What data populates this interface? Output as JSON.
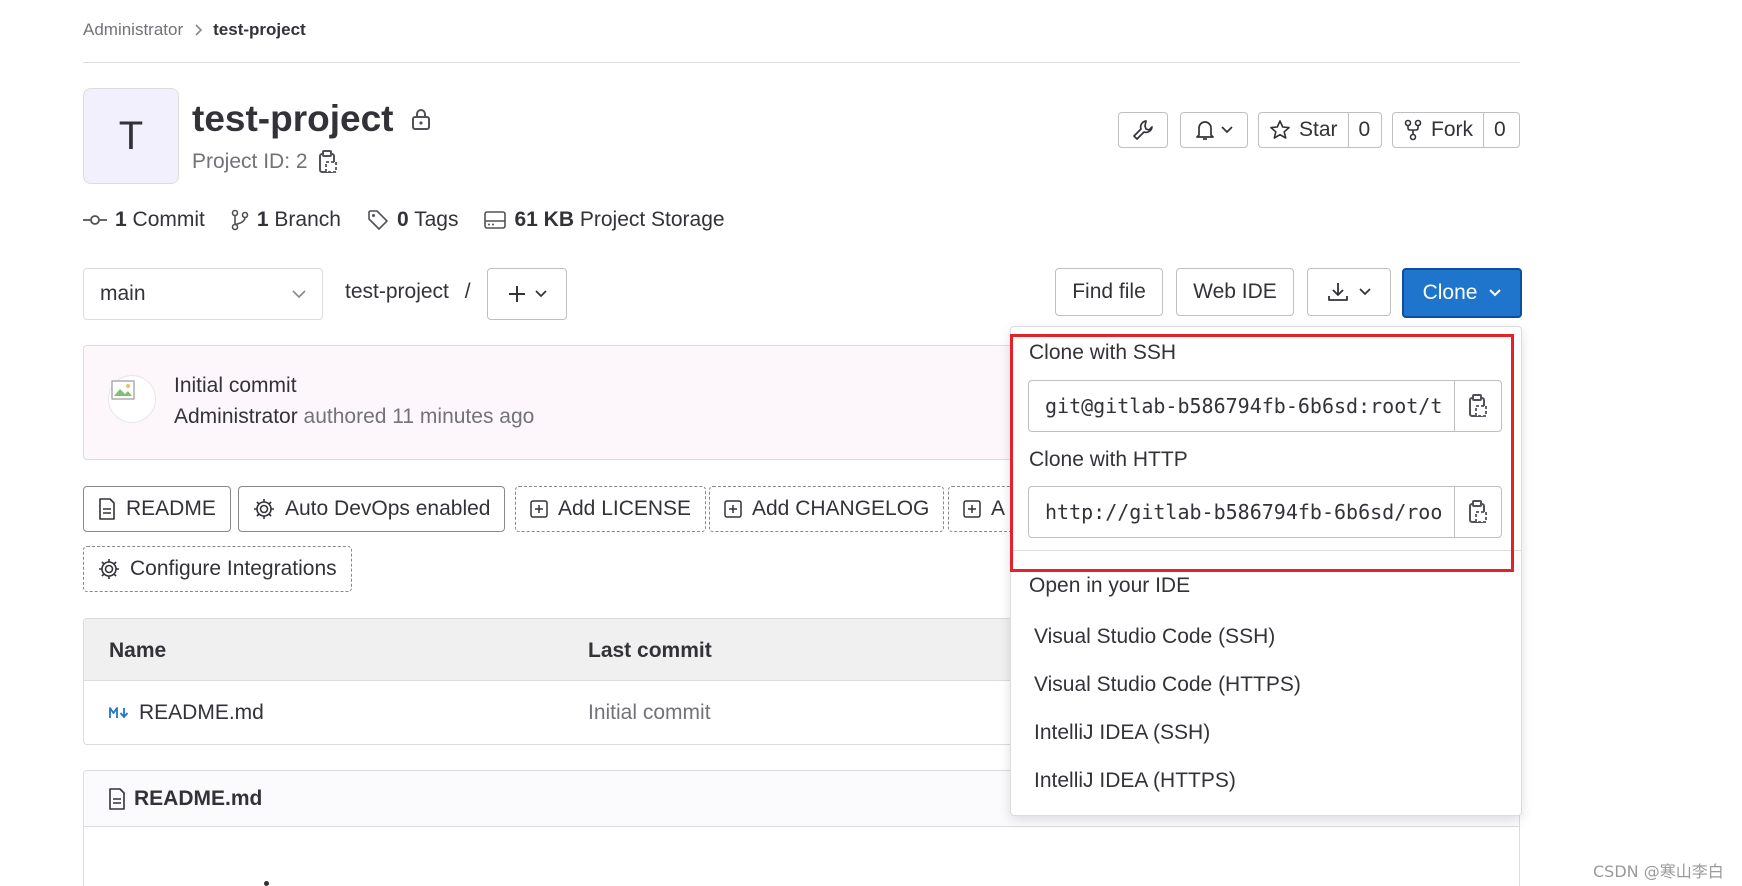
{
  "breadcrumb": {
    "parent": "Administrator",
    "current": "test-project"
  },
  "project": {
    "avatar_letter": "T",
    "name": "test-project",
    "id_text": "Project ID: 2"
  },
  "header_actions": {
    "star_label": "Star",
    "star_count": "0",
    "fork_label": "Fork",
    "fork_count": "0"
  },
  "stats": {
    "commits_num": "1",
    "commits_label": "Commit",
    "branches_num": "1",
    "branches_label": "Branch",
    "tags_num": "0",
    "tags_label": "Tags",
    "storage_num": "61 KB",
    "storage_label": "Project Storage"
  },
  "toolbar": {
    "branch": "main",
    "path": "test-project",
    "path_sep": "/",
    "find_file": "Find file",
    "web_ide": "Web IDE",
    "clone": "Clone"
  },
  "commit": {
    "title": "Initial commit",
    "author": "Administrator",
    "meta": "authored 11 minutes ago"
  },
  "quick_actions": {
    "readme": "README",
    "auto_devops": "Auto DevOps enabled",
    "add_license": "Add LICENSE",
    "add_changelog": "Add CHANGELOG",
    "add_partial": "A",
    "configure_integrations": "Configure Integrations"
  },
  "file_table": {
    "headers": [
      "Name",
      "Last commit"
    ],
    "rows": [
      {
        "name": "README.md",
        "last_commit": "Initial commit"
      }
    ]
  },
  "readme_panel": {
    "title": "README.md"
  },
  "clone_dropdown": {
    "ssh_label": "Clone with SSH",
    "ssh_url": "git@gitlab-b586794fb-6b6sd:root/t",
    "http_label": "Clone with HTTP",
    "http_url": "http://gitlab-b586794fb-6b6sd/roo",
    "ide_label": "Open in your IDE",
    "ide_items": [
      "Visual Studio Code (SSH)",
      "Visual Studio Code (HTTPS)",
      "IntelliJ IDEA (SSH)",
      "IntelliJ IDEA (HTTPS)"
    ]
  },
  "watermark": "CSDN @寒山李白",
  "colors": {
    "accent": "#1f75cb",
    "highlight": "#e3232c"
  }
}
